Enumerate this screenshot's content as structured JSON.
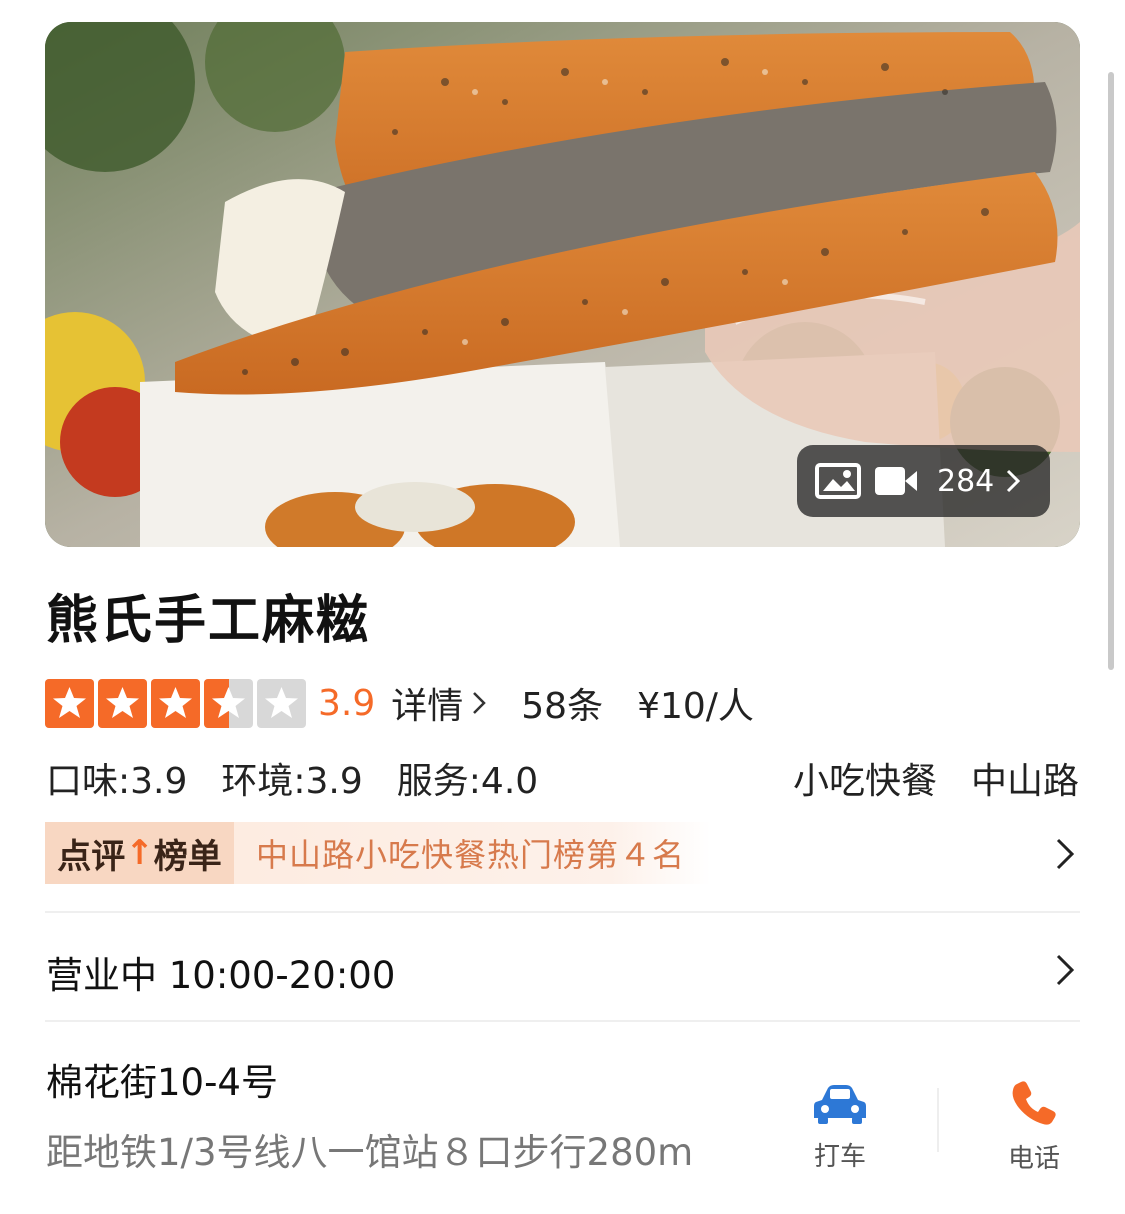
{
  "hero": {
    "media_count": "284",
    "image_icon": "image-icon",
    "video_icon": "video-icon"
  },
  "shop": {
    "name": "熊氏手工麻糍",
    "rating": 3.5,
    "score": "3.9",
    "details_label": "详情",
    "review_count": "58条",
    "price": "¥10/人",
    "sub_scores": [
      "口味:3.9",
      "环境:3.9",
      "服务:4.0"
    ],
    "category": "小吃快餐",
    "area": "中山路"
  },
  "rank": {
    "label_part1": "点评",
    "label_arrow": "↑",
    "label_part2": "榜单",
    "text": "中山路小吃快餐热门榜第４名"
  },
  "hours": {
    "text": "营业中 10:00-20:00"
  },
  "location": {
    "address": "棉花街10-4号",
    "metro": "距地铁1/3号线八一馆站８口步行280m"
  },
  "actions": {
    "taxi": {
      "label": "打车",
      "icon": "car-icon"
    },
    "phone": {
      "label": "电话",
      "icon": "phone-icon"
    }
  },
  "colors": {
    "accent": "#f56a28",
    "rank_text": "#d77a4c",
    "car_blue": "#2d78d6"
  }
}
